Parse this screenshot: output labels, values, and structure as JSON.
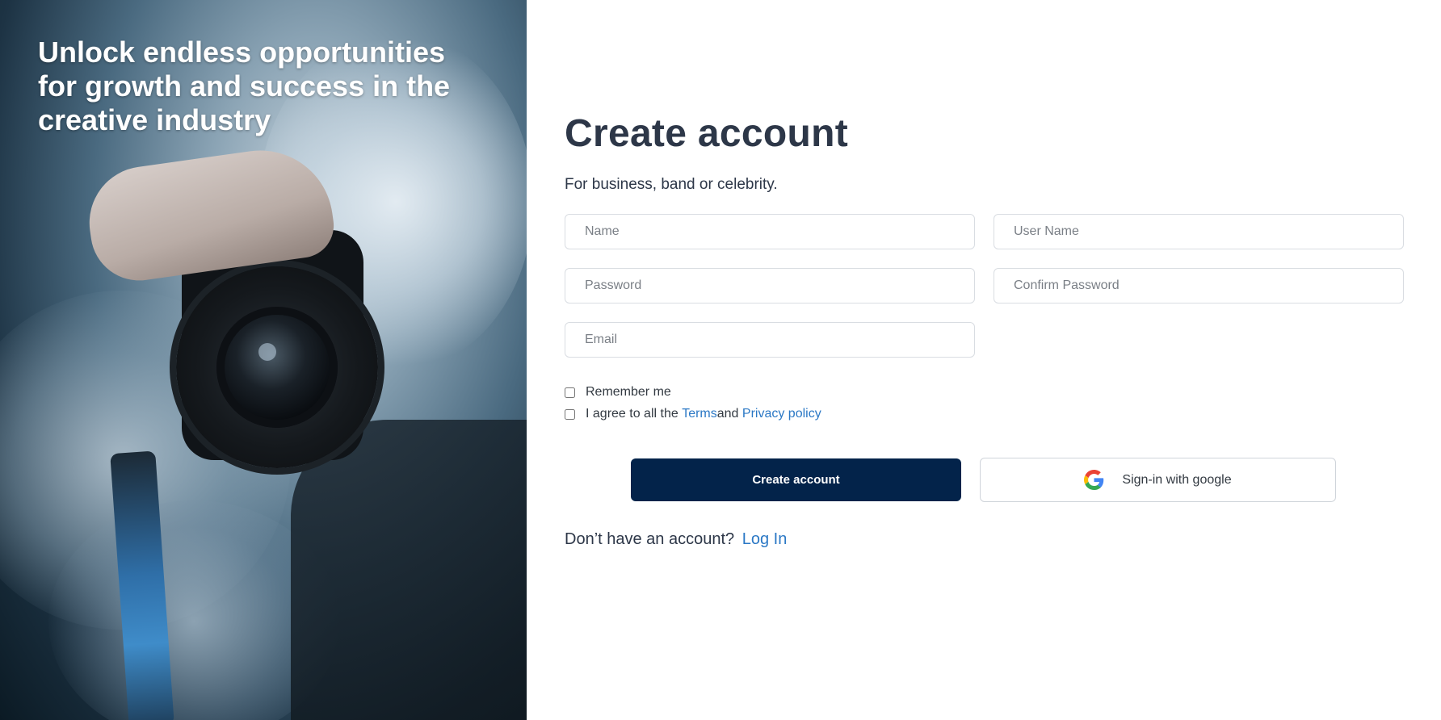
{
  "hero": {
    "title": "Unlock endless opportunities for growth and success in the creative industry"
  },
  "form": {
    "title": "Create account",
    "subtitle": "For business, band or celebrity.",
    "fields": {
      "name_placeholder": "Name",
      "username_placeholder": "User Name",
      "password_placeholder": "Password",
      "confirm_password_placeholder": "Confirm Password",
      "email_placeholder": "Email"
    },
    "remember_label": "Remember me",
    "agree_prefix": "I agree to all the ",
    "terms_link": "Terms",
    "agree_middle": "and ",
    "privacy_link": "Privacy policy",
    "create_button": "Create account",
    "google_button": "Sign-in with google",
    "footer_prompt": "Don’t have an account?",
    "login_link": "Log In"
  },
  "colors": {
    "primary_button": "#03234a",
    "link": "#2b78c5",
    "heading": "#2d3748"
  }
}
